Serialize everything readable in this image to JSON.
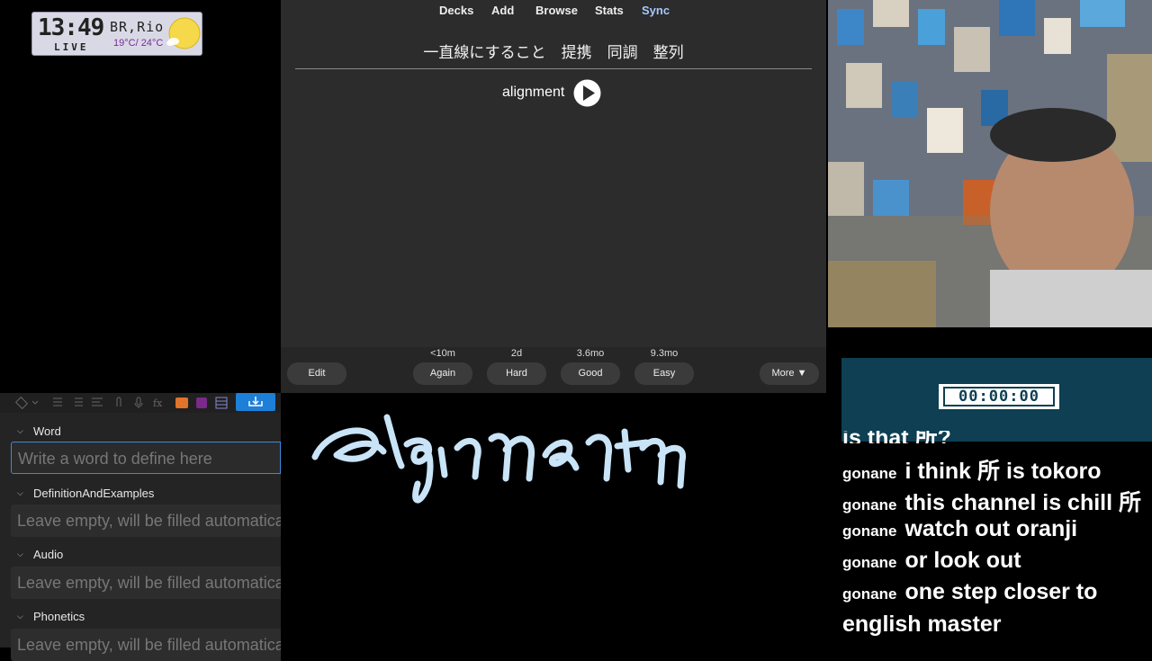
{
  "weather": {
    "time": "13:49",
    "live": "LIVE",
    "city": "BR,Rio",
    "temps": "19°C/ 24°C"
  },
  "anki": {
    "nav": [
      "Decks",
      "Add",
      "Browse",
      "Stats",
      "Sync"
    ],
    "question": "一直線にすること　提携　同調　整列",
    "answer": "alignment",
    "buttons": {
      "edit": "Edit",
      "again": {
        "label": "Again",
        "interval": "<10m"
      },
      "hard": {
        "label": "Hard",
        "interval": "2d"
      },
      "good": {
        "label": "Good",
        "interval": "3.6mo"
      },
      "easy": {
        "label": "Easy",
        "interval": "9.3mo"
      },
      "more": "More ▼"
    }
  },
  "editor": {
    "fields": [
      {
        "label": "Word",
        "placeholder": "Write a word to define here"
      },
      {
        "label": "DefinitionAndExamples",
        "placeholder": "Leave empty, will be filled automatically"
      },
      {
        "label": "Audio",
        "placeholder": "Leave empty, will be filled automatically"
      },
      {
        "label": "Phonetics",
        "placeholder": "Leave empty, will be filled automatically"
      }
    ]
  },
  "timer": "00:00:00",
  "chat": {
    "partial": "is that 所?",
    "messages": [
      {
        "user": "gonane",
        "text": "i think 所 is tokoro"
      },
      {
        "user": "gonane",
        "text": "this channel is chill 所"
      },
      {
        "user": "gonane",
        "text": "watch out oranji"
      },
      {
        "user": "gonane",
        "text": "or look out"
      },
      {
        "user": "gonane",
        "text": "one step closer to"
      }
    ],
    "continuation": "english master"
  },
  "colors": {
    "accent": "#1e7fd8",
    "sync": "#a5c8ff",
    "timer_bg": "#0e3f52",
    "handwriting": "#c9e4f7"
  }
}
